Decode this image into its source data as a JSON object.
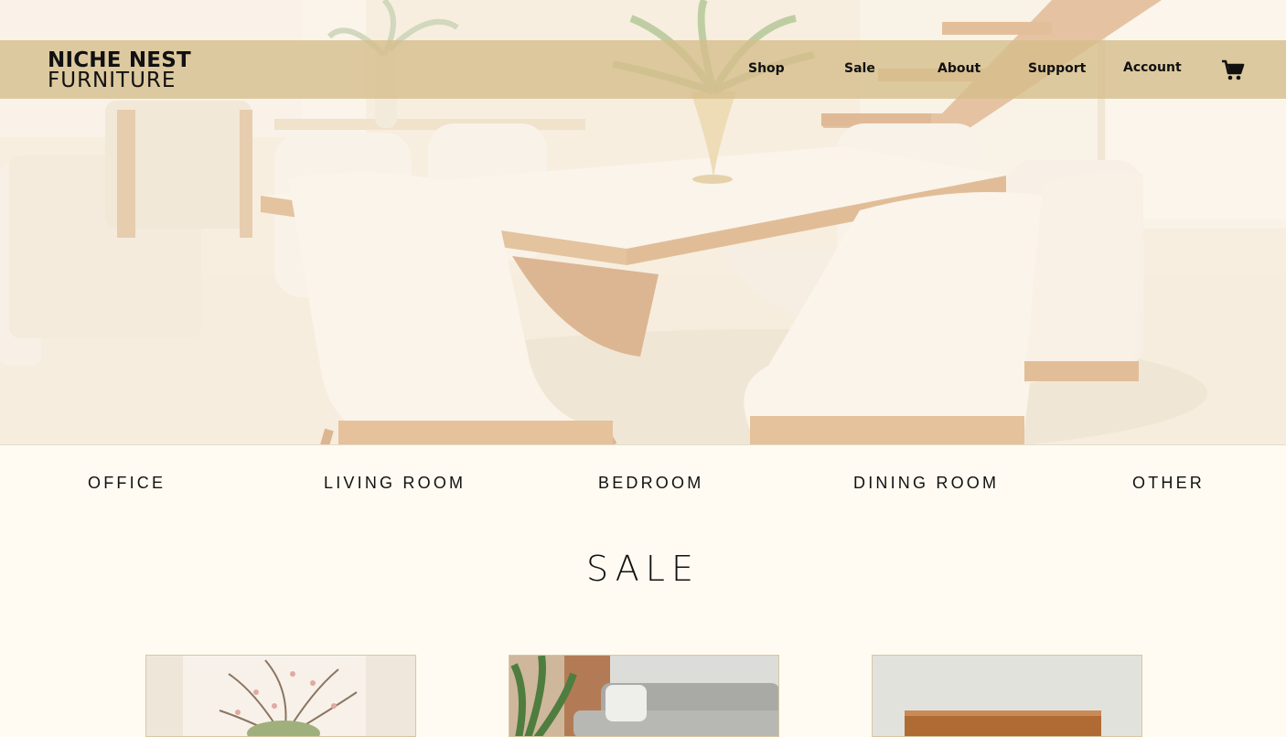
{
  "brand": {
    "line1": "NICHE NEST",
    "line2": "FURNITURE"
  },
  "nav": {
    "shop": "Shop",
    "sale": "Sale",
    "about": "About",
    "support": "Support",
    "account": "Account"
  },
  "icons": {
    "cart": "cart-icon"
  },
  "categories": [
    "OFFICE",
    "LIVING ROOM",
    "BEDROOM",
    "DINING ROOM",
    "OTHER"
  ],
  "sale_heading": "SALE",
  "colors": {
    "nav_bar": "#d6be8c",
    "page_bg": "#fffbf2",
    "card_border": "#d8c7a2",
    "text": "#111111"
  }
}
